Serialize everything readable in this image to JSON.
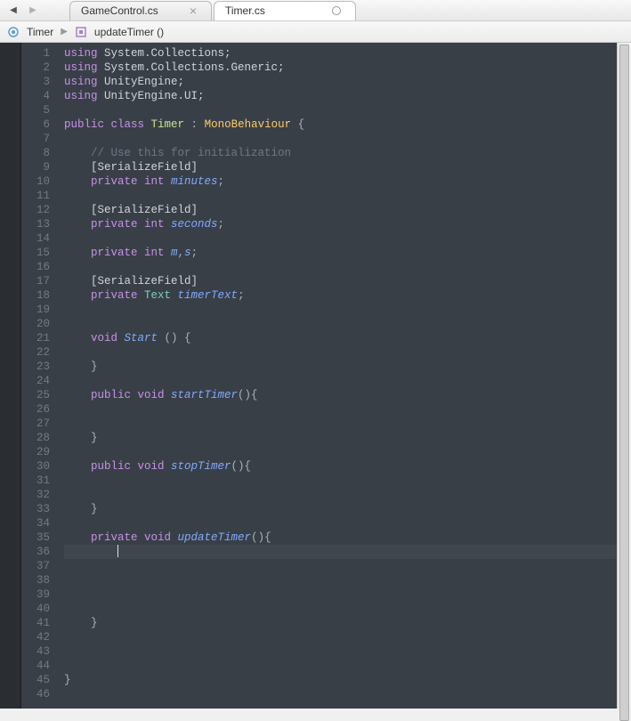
{
  "tabs": [
    {
      "label": "GameControl.cs",
      "active": false
    },
    {
      "label": "Timer.cs",
      "active": true
    }
  ],
  "breadcrumb": {
    "class": "Timer",
    "method": "updateTimer ()"
  },
  "code": {
    "lines": [
      {
        "n": 1,
        "tokens": [
          {
            "t": "using ",
            "c": "kw"
          },
          {
            "t": "System.Collections;",
            "c": "ident"
          }
        ]
      },
      {
        "n": 2,
        "tokens": [
          {
            "t": "using ",
            "c": "kw"
          },
          {
            "t": "System.Collections.Generic;",
            "c": "ident"
          }
        ]
      },
      {
        "n": 3,
        "tokens": [
          {
            "t": "using ",
            "c": "kw"
          },
          {
            "t": "UnityEngine;",
            "c": "ident"
          }
        ]
      },
      {
        "n": 4,
        "tokens": [
          {
            "t": "using ",
            "c": "kw"
          },
          {
            "t": "UnityEngine.UI;",
            "c": "ident"
          }
        ]
      },
      {
        "n": 5,
        "tokens": []
      },
      {
        "n": 6,
        "tokens": [
          {
            "t": "public class ",
            "c": "kw"
          },
          {
            "t": "Timer",
            "c": "str"
          },
          {
            "t": " : ",
            "c": "punct"
          },
          {
            "t": "MonoBehaviour",
            "c": "classref"
          },
          {
            "t": " {",
            "c": "punct"
          }
        ]
      },
      {
        "n": 7,
        "tokens": []
      },
      {
        "n": 8,
        "tokens": [
          {
            "t": "    ",
            "c": ""
          },
          {
            "t": "// Use this for initialization",
            "c": "comment"
          }
        ]
      },
      {
        "n": 9,
        "tokens": [
          {
            "t": "    [SerializeField]",
            "c": "ident"
          }
        ]
      },
      {
        "n": 10,
        "tokens": [
          {
            "t": "    ",
            "c": ""
          },
          {
            "t": "private int ",
            "c": "kw"
          },
          {
            "t": "minutes",
            "c": "name"
          },
          {
            "t": ";",
            "c": "punct"
          }
        ]
      },
      {
        "n": 11,
        "tokens": []
      },
      {
        "n": 12,
        "tokens": [
          {
            "t": "    [SerializeField]",
            "c": "ident"
          }
        ]
      },
      {
        "n": 13,
        "tokens": [
          {
            "t": "    ",
            "c": ""
          },
          {
            "t": "private int ",
            "c": "kw"
          },
          {
            "t": "seconds",
            "c": "name"
          },
          {
            "t": ";",
            "c": "punct"
          }
        ]
      },
      {
        "n": 14,
        "tokens": []
      },
      {
        "n": 15,
        "tokens": [
          {
            "t": "    ",
            "c": ""
          },
          {
            "t": "private int ",
            "c": "kw"
          },
          {
            "t": "m",
            "c": "name"
          },
          {
            "t": ",",
            "c": "punct"
          },
          {
            "t": "s",
            "c": "name"
          },
          {
            "t": ";",
            "c": "punct"
          }
        ]
      },
      {
        "n": 16,
        "tokens": []
      },
      {
        "n": 17,
        "tokens": [
          {
            "t": "    [SerializeField]",
            "c": "ident"
          }
        ]
      },
      {
        "n": 18,
        "tokens": [
          {
            "t": "    ",
            "c": ""
          },
          {
            "t": "private ",
            "c": "kw"
          },
          {
            "t": "Text ",
            "c": "type2"
          },
          {
            "t": "timerText",
            "c": "name"
          },
          {
            "t": ";",
            "c": "punct"
          }
        ]
      },
      {
        "n": 19,
        "tokens": []
      },
      {
        "n": 20,
        "tokens": []
      },
      {
        "n": 21,
        "tokens": [
          {
            "t": "    ",
            "c": ""
          },
          {
            "t": "void ",
            "c": "kw"
          },
          {
            "t": "Start",
            "c": "name"
          },
          {
            "t": " () {",
            "c": "punct"
          }
        ]
      },
      {
        "n": 22,
        "tokens": []
      },
      {
        "n": 23,
        "tokens": [
          {
            "t": "    }",
            "c": "punct"
          }
        ]
      },
      {
        "n": 24,
        "tokens": []
      },
      {
        "n": 25,
        "tokens": [
          {
            "t": "    ",
            "c": ""
          },
          {
            "t": "public void ",
            "c": "kw"
          },
          {
            "t": "startTimer",
            "c": "name"
          },
          {
            "t": "(){",
            "c": "punct"
          }
        ]
      },
      {
        "n": 26,
        "tokens": []
      },
      {
        "n": 27,
        "tokens": []
      },
      {
        "n": 28,
        "tokens": [
          {
            "t": "    }",
            "c": "punct"
          }
        ]
      },
      {
        "n": 29,
        "tokens": []
      },
      {
        "n": 30,
        "tokens": [
          {
            "t": "    ",
            "c": ""
          },
          {
            "t": "public void ",
            "c": "kw"
          },
          {
            "t": "stopTimer",
            "c": "name"
          },
          {
            "t": "(){",
            "c": "punct"
          }
        ]
      },
      {
        "n": 31,
        "tokens": []
      },
      {
        "n": 32,
        "tokens": []
      },
      {
        "n": 33,
        "tokens": [
          {
            "t": "    }",
            "c": "punct"
          }
        ]
      },
      {
        "n": 34,
        "tokens": []
      },
      {
        "n": 35,
        "tokens": [
          {
            "t": "    ",
            "c": ""
          },
          {
            "t": "private void ",
            "c": "kw"
          },
          {
            "t": "updateTimer",
            "c": "name"
          },
          {
            "t": "(){",
            "c": "punct"
          }
        ]
      },
      {
        "n": 36,
        "tokens": [
          {
            "t": "        ",
            "c": ""
          }
        ],
        "current": true,
        "cursor": true
      },
      {
        "n": 37,
        "tokens": []
      },
      {
        "n": 38,
        "tokens": []
      },
      {
        "n": 39,
        "tokens": []
      },
      {
        "n": 40,
        "tokens": []
      },
      {
        "n": 41,
        "tokens": [
          {
            "t": "    }",
            "c": "punct"
          }
        ]
      },
      {
        "n": 42,
        "tokens": []
      },
      {
        "n": 43,
        "tokens": []
      },
      {
        "n": 44,
        "tokens": []
      },
      {
        "n": 45,
        "tokens": [
          {
            "t": "}",
            "c": "punct"
          }
        ]
      },
      {
        "n": 46,
        "tokens": []
      }
    ]
  }
}
